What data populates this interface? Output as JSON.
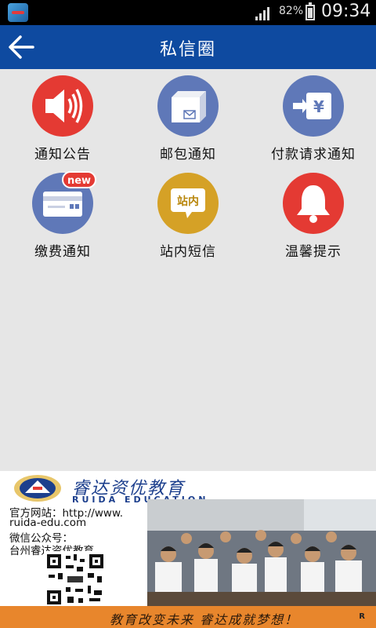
{
  "status_bar": {
    "battery_percent": "82%",
    "time": "09:34"
  },
  "header": {
    "title": "私信圈"
  },
  "menu": [
    {
      "label": "通知公告",
      "icon": "megaphone-icon",
      "color": "#e43a33"
    },
    {
      "label": "邮包通知",
      "icon": "parcel-icon",
      "color": "#5f78b8"
    },
    {
      "label": "付款请求通知",
      "icon": "payment-request-icon",
      "color": "#5f78b8"
    },
    {
      "label": "缴费通知",
      "icon": "card-new-icon",
      "color": "#5f78b8",
      "badge": "new"
    },
    {
      "label": "站内短信",
      "icon": "message-bubble-icon",
      "color": "#d5a126",
      "icon_text": "站内"
    },
    {
      "label": "温馨提示",
      "icon": "bell-icon",
      "color": "#e43a33"
    }
  ],
  "payment_icon_symbol": "¥",
  "banner": {
    "brand": "睿达资优教育",
    "brand_en": "RUIDA  EDUCATION",
    "website_label": "官方网站：http://www.",
    "website_domain": "ruida-edu.com",
    "wechat_label": "微信公众号：",
    "wechat_name": "台州睿达资优教育",
    "slogan": "教育改变未来   睿达成就梦想！",
    "mark": "R"
  }
}
